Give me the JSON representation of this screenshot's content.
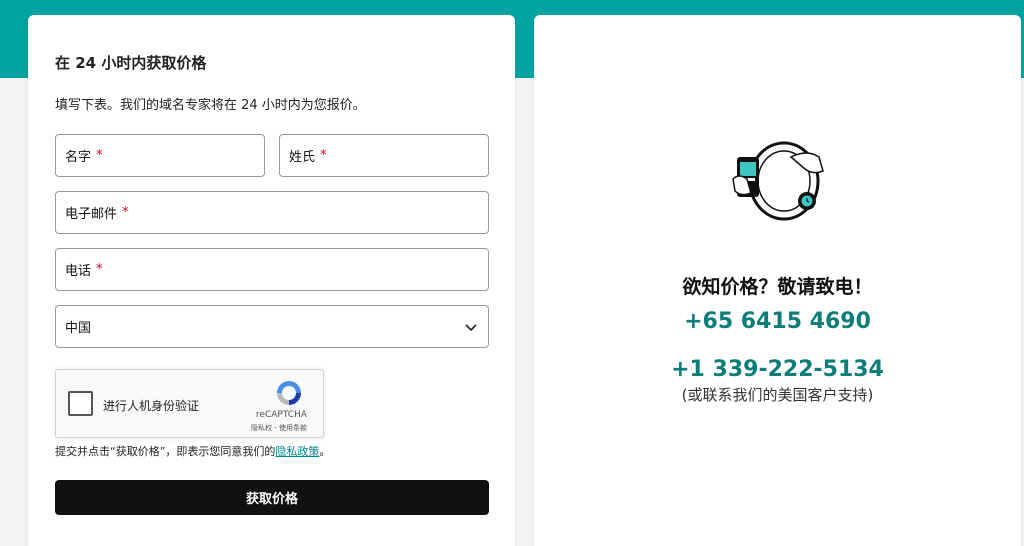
{
  "form": {
    "title": "在 24 小时内获取价格",
    "description": "填写下表。我们的域名专家将在 24 小时内为您报价。",
    "first_name_label": "名字",
    "last_name_label": "姓氏",
    "email_label": "电子邮件",
    "phone_label": "电话",
    "required_mark": "*",
    "country_value": "中国",
    "recaptcha": {
      "label": "进行人机身份验证",
      "brand": "reCAPTCHA",
      "privacy": "隐私权",
      "separator": " - ",
      "terms": "使用条款"
    },
    "consent_prefix": "提交并点击“获取价格”，即表示您同意我们的",
    "consent_link": "隐私政策",
    "consent_suffix": "。",
    "submit_label": "获取价格"
  },
  "info": {
    "heading": "欲知价格？敬请致电！",
    "phone_sg": "+65 6415 4690",
    "phone_us": "+1 339-222-5134",
    "us_support_note": "(或联系我们的美国客户支持)"
  },
  "colors": {
    "accent": "#00a3a1",
    "phone_text": "#0c7d78",
    "button": "#111111"
  },
  "icons": [
    "chevron-down-icon",
    "recaptcha-logo-icon",
    "phone-in-hand-icon",
    "alarm-clock-icon"
  ]
}
